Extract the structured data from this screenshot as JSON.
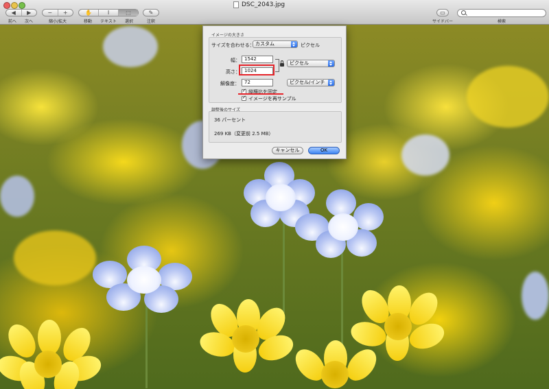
{
  "window": {
    "title": "DSC_2043.jpg"
  },
  "toolbar": {
    "prev_label": "前へ",
    "next_label": "次へ",
    "zoom_label": "縮小/拡大",
    "move_label": "移動",
    "text_label": "テキスト",
    "select_label": "選択",
    "annotate_label": "注釈",
    "sidebar_label": "サイドバー",
    "search_label": "検索",
    "search_placeholder": ""
  },
  "dialog": {
    "image_size_section": "イメージの大きさ",
    "fit_label": "サイズを合わせる：",
    "fit_value": "カスタム",
    "fit_unit": "ピクセル",
    "width_label": "幅：",
    "width_value": "1542",
    "height_label": "高さ：",
    "height_value": "1024",
    "resolution_label": "解像度：",
    "resolution_value": "72",
    "size_unit_value": "ピクセル",
    "resolution_unit_value": "ピクセル/インチ",
    "constrain_label": "縦横比を固定",
    "constrain_checked": true,
    "resample_label": "イメージを再サンプル",
    "resample_checked": true,
    "result_section": "調整後のサイズ",
    "percent_text": "36 パーセント",
    "filesize_text": "269 KB（変更前 2.5 MB）",
    "cancel_label": "キャンセル",
    "ok_label": "OK"
  },
  "colors": {
    "annotation_red": "#e6242a",
    "primary_button": "#3c84f2"
  }
}
